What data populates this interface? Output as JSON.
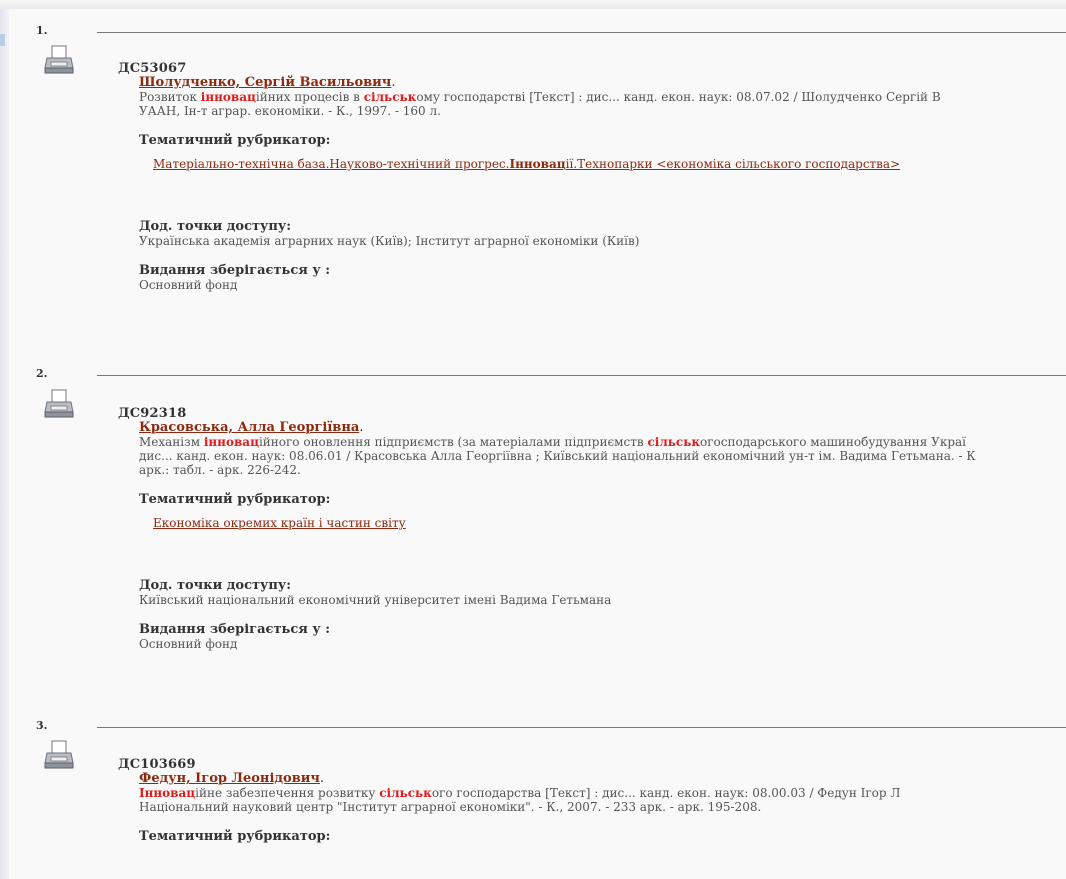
{
  "labels": {
    "rubricator": "Тематичний рубрикатор:",
    "access_points": "Дод. точки доступу:",
    "stored_in": "Видання зберігається у :"
  },
  "records": [
    {
      "num": "1.",
      "shelf": "ДС53067",
      "author": "Шолудченко, Сергій Васильович",
      "desc_line1": [
        "Розвиток ",
        "інновац",
        "ійних процесів в ",
        "сільськ",
        "ому господарстві [Текст] : дис... канд. екон. наук: 08.07.02 / Шолудченко Сергій В"
      ],
      "desc_line2": "УААН, Ін-т аграр. економіки. - К., 1997. - 160 л.",
      "rubric": [
        "Матеріально-технічна база.Науково-технічний прогрес.",
        "Інновац",
        "ії.Технопарки <економіка сільського господарства>"
      ],
      "access": "Українська академія аграрних наук (Київ); Інститут аграрної економіки (Київ)",
      "stored": "Основний фонд"
    },
    {
      "num": "2.",
      "shelf": "ДС92318",
      "author": "Красовська, Алла Георгіївна",
      "desc_line1": [
        "Механізм ",
        "інновац",
        "ійного оновлення підприємств (за матеріалами підприємств ",
        "сільськ",
        "огосподарського машинобудування Украї"
      ],
      "desc_line2": "дис... канд. екон. наук: 08.06.01 / Красовська Алла Георгіївна ; Київський національний економічний ун-т ім. Вадима Гетьмана. - К",
      "desc_line3": "арк.: табл. - арк. 226-242.",
      "rubric": [
        "Економіка окремих країн і частин світу"
      ],
      "access": "Київський національний економічний університет імені Вадима Гетьмана",
      "stored": "Основний фонд"
    },
    {
      "num": "3.",
      "shelf": "ДС103669",
      "author": "Федун, Ігор Леонідович",
      "desc_line1": [
        "",
        "Інновац",
        "ійне забезпечення розвитку ",
        "сільськ",
        "ого господарства [Текст] : дис... канд. екон. наук: 08.00.03 / Федун Ігор Л"
      ],
      "desc_line2": "Національний науковий центр \"Інститут аграрної економіки\". - К., 2007. - 233 арк. - арк. 195-208."
    }
  ],
  "icons": {
    "print": "printer-icon"
  }
}
